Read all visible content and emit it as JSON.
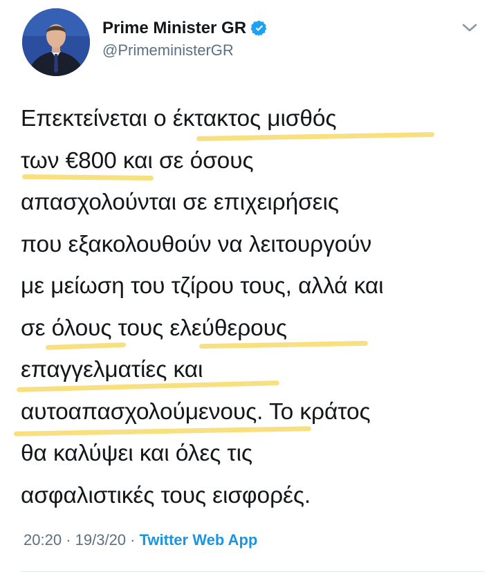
{
  "tweet": {
    "author_name": "Prime Minister GR",
    "author_handle": "@PrimeministerGR",
    "lines": [
      "Επεκτείνεται ο έκτακτος μισθός",
      "των €800 και σε όσους",
      "απασχολούνται σε επιχειρήσεις",
      "που εξακολουθούν να λειτουργούν",
      "με μείωση του τζίρου τους, αλλά και",
      "σε όλους τους ελεύθερους",
      "επαγγελματίες και",
      "αυτοαπασχολούμενους. Το κράτος",
      "θα καλύψει και όλες τις",
      "ασφαλιστικές τους εισφορές."
    ],
    "time": "20:20",
    "date": "19/3/20",
    "separator": "·",
    "source": "Twitter Web App"
  },
  "icons": {
    "verified": "verified-badge-icon",
    "menu": "chevron-down-icon"
  },
  "colors": {
    "verified_blue": "#1da1f2",
    "highlighter": "#f7dd72",
    "link_blue": "#1b95e0",
    "muted_gray": "#5b7083"
  }
}
